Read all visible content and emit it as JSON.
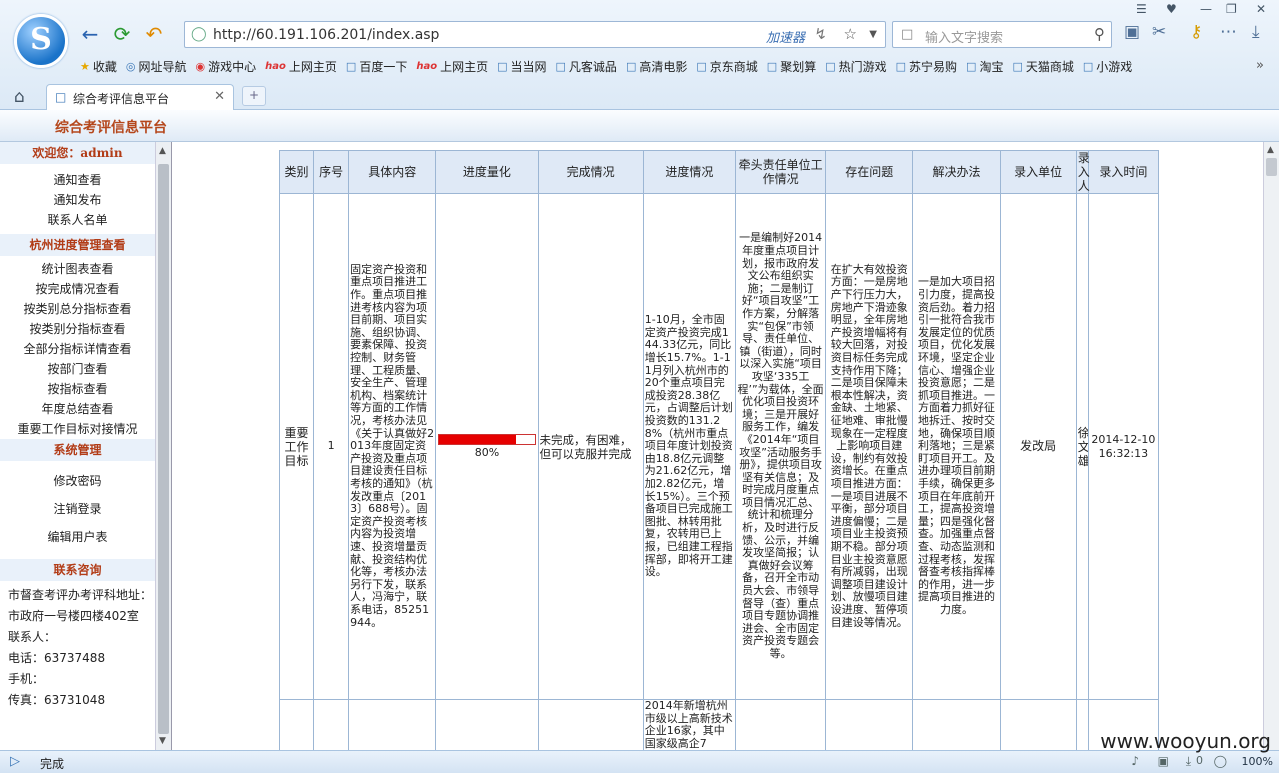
{
  "browser": {
    "url": "http://60.191.106.201/index.asp",
    "accelerator_label": "加速器",
    "search_placeholder": "输入文字搜索",
    "tab_title": "综合考评信息平台",
    "new_tab": "+",
    "bookmarks": [
      {
        "label": "收藏",
        "icon": "star-icon"
      },
      {
        "label": "网址导航",
        "icon": "globe-icon"
      },
      {
        "label": "游戏中心",
        "icon": "game-icon"
      },
      {
        "label": "上网主页",
        "icon": "hao-icon"
      },
      {
        "label": "百度一下",
        "icon": "page-icon"
      },
      {
        "label": "上网主页",
        "icon": "hao-icon"
      },
      {
        "label": "当当网",
        "icon": "page-icon"
      },
      {
        "label": "凡客诚品",
        "icon": "page-icon"
      },
      {
        "label": "高清电影",
        "icon": "page-icon"
      },
      {
        "label": "京东商城",
        "icon": "page-icon"
      },
      {
        "label": "聚划算",
        "icon": "page-icon"
      },
      {
        "label": "热门游戏",
        "icon": "page-icon"
      },
      {
        "label": "苏宁易购",
        "icon": "page-icon"
      },
      {
        "label": "淘宝",
        "icon": "page-icon"
      },
      {
        "label": "天猫商城",
        "icon": "page-icon"
      },
      {
        "label": "小游戏",
        "icon": "page-icon"
      }
    ],
    "more_bookmarks": "»",
    "status_text": "完成",
    "zoom": "100%",
    "download_count": "0",
    "watermark": "www.wooyun.org"
  },
  "app": {
    "title": "综合考评信息平台"
  },
  "sidebar": {
    "welcome": "欢迎您：admin",
    "group1": [
      "通知查看",
      "通知发布",
      "联系人名单"
    ],
    "hz_header": "杭州进度管理查看",
    "hz_items": [
      "统计图表查看",
      "按完成情况查看",
      "按类别总分指标查看",
      "按类别分指标查看",
      "全部分指标详情查看",
      "按部门查看",
      "按指标查看",
      "年度总结查看",
      "重要工作目标对接情况"
    ],
    "sys_header": "系统管理",
    "sys_items": [
      "修改密码",
      "注销登录",
      "编辑用户表"
    ],
    "contact_header": "联系咨询",
    "contact_lines": [
      "市督查考评办考评科地址：",
      "市政府一号楼四楼402室",
      "联系人：",
      "电话：63737488",
      "手机：",
      "传真：63731048"
    ]
  },
  "table": {
    "headers": [
      "类别",
      "序号",
      "具体内容",
      "进度量化",
      "完成情况",
      "进度情况",
      "牵头责任单位工作情况",
      "存在问题",
      "解决办法",
      "录入单位",
      "录入人",
      "录入时间"
    ],
    "row1": {
      "category": "重要工作目标",
      "index": "1",
      "content": "固定资产投资和重点项目推进工作。重点项目推进考核内容为项目前期、项目实施、组织协调、要素保障、投资控制、财务管理、工程质量、安全生产、管理机构、档案统计等方面的工作情况，考核办法见《关于认真做好2013年度固定资产投资及重点项目建设责任目标考核的通知》（杭发改重点〔2013〕688号）。固定资产投资考核内容为投资增速、投资增量贡献、投资结构优化等，考核办法另行下发，联系人，冯海宁，联系电话，85251944。",
      "progress_pct": 80,
      "progress_label": "80%",
      "completion": "未完成，有困难，但可以克服并完成",
      "status": "1-10月，全市固定资产投资完成144.33亿元，同比增长15.7%。1-11月列入杭州市的20个重点项目完成投资28.38亿元，占调整后计划投资数的131.28%（杭州市重点项目年度计划投资由18.8亿元调整为21.62亿元，增加2.82亿元，增长15%）。三个预备项目已完成施工图批、林转用批复，农转用已上报，已组建工程指挥部，即将开工建设。",
      "lead_unit": "一是编制好2014年度重点项目计划，报市政府发文公布组织实施；二是制订好“项目攻坚”工作方案，分解落实“包保”市领导、责任单位、镇（街道），同时以深入实施“项目攻坚‘335工程’”为载体，全面优化项目投资环境；三是开展好服务工作，编发《2014年“项目攻坚”活动服务手册》，提供项目攻坚有关信息；及时完成月度重点项目情况汇总、统计和梳理分析，及时进行反馈、公示，并编发攻坚简报；认真做好会议筹备，召开全市动员大会、市领导督导（查）重点项目专题协调推进会、全市固定资产投资专题会等。",
      "problems": "在扩大有效投资方面：一是房地产下行压力大，房地产下滑迹象明显，全年房地产投资增幅将有较大回落，对投资目标任务完成支持作用下降；二是项目保障未根本性解决，资金缺、土地紧、征地难、审批慢现象在一定程度上影响项目建设，制约有效投资增长。在重点项目推进方面：一是项目进展不平衡，部分项目进度偏慢；二是项目业主投资预期不稳。部分项目业主投资意愿有所减弱，出现调整项目建设计划、放慢项目建设进度、暂停项目建设等情况。",
      "solutions": "一是加大项目招引力度，提高投资后劲。着力招引一批符合我市发展定位的优质项目，优化发展环境，坚定企业信心、增强企业投资意愿；二是抓项目推进。一方面着力抓好征地拆迁、按时交地，确保项目顺利落地；三是紧盯项目开工。及进办理项目前期手续，确保更多项目在年底前开工，提高投资增量；四是强化督查。加强重点督查、动态监测和过程考核，发挥督查考核指挥棒的作用，进一步提高项目推进的力度。",
      "unit": "发改局",
      "person": "徐文雄",
      "time": "2014-12-10 16:32:13"
    },
    "row2": {
      "status": "2014年新增杭州市级以上高新技术企业16家，其中国家级高企7"
    }
  }
}
